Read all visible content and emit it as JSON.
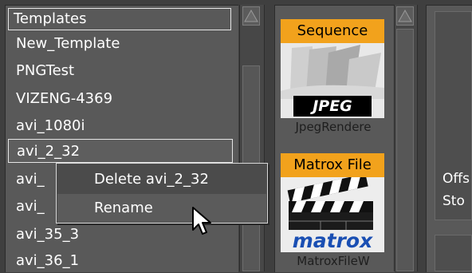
{
  "templates": {
    "header": "Templates",
    "items": [
      {
        "label": "New_Template",
        "selected": false
      },
      {
        "label": "PNGTest",
        "selected": false
      },
      {
        "label": "VIZENG-4369",
        "selected": false
      },
      {
        "label": "avi_1080i",
        "selected": false
      },
      {
        "label": "avi_2_32",
        "selected": true
      },
      {
        "label": "avi_",
        "selected": false
      },
      {
        "label": "avi_",
        "selected": false
      },
      {
        "label": "avi_35_3",
        "selected": false
      },
      {
        "label": "avi_36_1",
        "selected": false
      }
    ]
  },
  "context_menu": {
    "items": [
      {
        "label": "Delete avi_2_32"
      },
      {
        "label": "Rename"
      }
    ]
  },
  "renderers": [
    {
      "label": "Sequence",
      "image_text": "JPEG",
      "name": "JpegRendere",
      "icon": "jpeg-sequence-icon"
    },
    {
      "label": "Matrox File",
      "image_text": "matrox",
      "name": "MatroxFileW",
      "icon": "clapperboard-icon"
    }
  ],
  "properties": {
    "line1": "Offs",
    "line2": "Sto"
  },
  "colors": {
    "tile_label_bg": "#f2a21c",
    "panel_bg": "#595959",
    "matrox_blue": "#1a4fb3"
  }
}
